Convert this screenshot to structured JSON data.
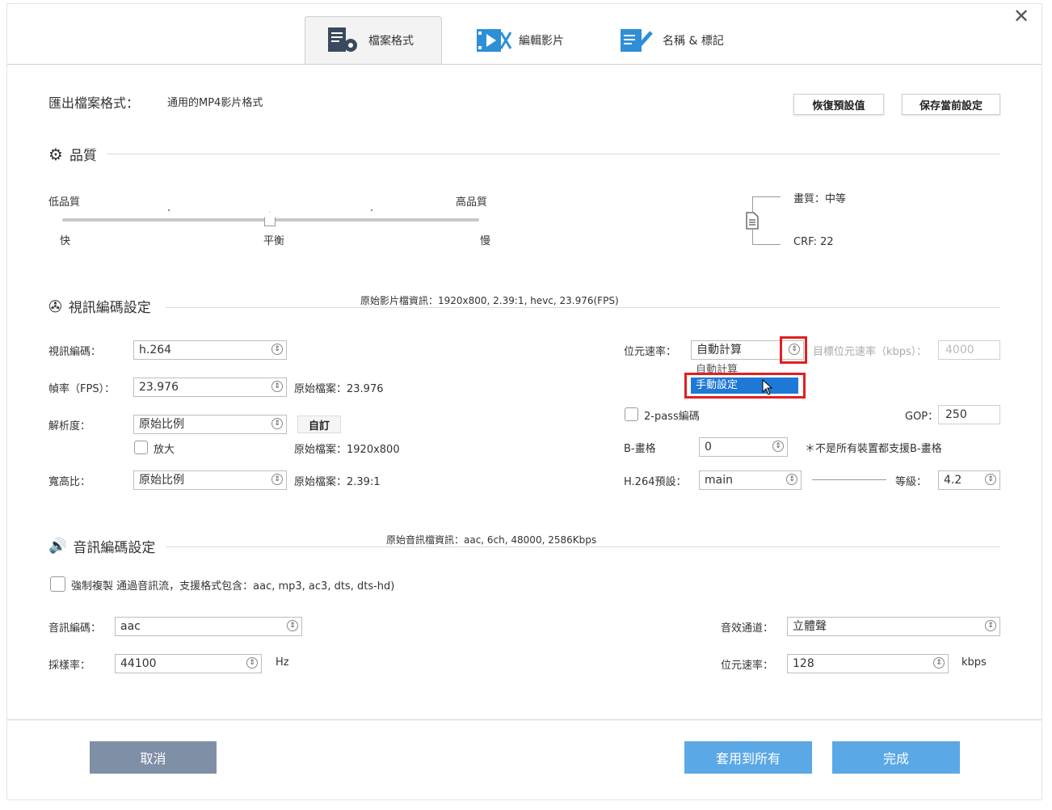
{
  "window": {
    "close_glyph": "✕"
  },
  "tabs": [
    {
      "label": "檔案格式",
      "icon": "file-settings-icon",
      "active": true
    },
    {
      "label": "編輯影片",
      "icon": "video-edit-icon",
      "active": false
    },
    {
      "label": "名稱 & 標記",
      "icon": "name-tag-icon",
      "active": false
    }
  ],
  "export": {
    "label": "匯出檔案格式：",
    "value": "通用的MP4影片格式",
    "restore_default": "恢復預設值",
    "save_current": "保存當前設定"
  },
  "quality": {
    "title": "品質",
    "low_label": "低品質",
    "high_label": "高品質",
    "fast_label": "快",
    "balance_label": "平衡",
    "slow_label": "慢",
    "slider_value": 0.5,
    "picture_quality": "畫質：中等",
    "crf": "CRF: 22"
  },
  "video": {
    "title": "視訊編碼設定",
    "source_info": "原始影片檔資訊：1920x800, 2.39:1, hevc, 23.976(FPS)",
    "codec_label": "視訊編碼：",
    "codec_value": "h.264",
    "fps_label": "幀率（FPS）：",
    "fps_value": "23.976",
    "fps_original": "原始檔案：23.976",
    "resolution_label": "解析度：",
    "resolution_value": "原始比例",
    "custom_button": "自訂",
    "upscale_label": "放大",
    "resolution_original": "原始檔案：1920x800",
    "aspect_label": "寬高比：",
    "aspect_value": "原始比例",
    "aspect_original": "原始檔案：2.39:1",
    "bitrate_label": "位元速率：",
    "bitrate_value": "自動計算",
    "bitrate_options": [
      "自動計算",
      "手動設定"
    ],
    "bitrate_highlighted": "手動設定",
    "target_bitrate_label": "目標位元速率（kbps）：",
    "target_bitrate_value": "4000",
    "twopass_label": "2-pass編碼",
    "gop_label": "GOP：",
    "gop_value": "250",
    "bframes_label": "B-畫格",
    "bframes_value": "0",
    "bframes_note": "＊不是所有裝置都支援B-畫格",
    "preset_label": "H.264預設：",
    "preset_value": "main",
    "level_label": "等級：",
    "level_value": "4.2"
  },
  "audio": {
    "title": "音訊編碼設定",
    "source_info": "原始音訊檔資訊：aac, 6ch, 48000, 2586Kbps",
    "passthrough_label": "強制複製 通過音訊流，支援格式包含：aac, mp3, ac3, dts, dts-hd)",
    "codec_label": "音訊編碼：",
    "codec_value": "aac",
    "samplerate_label": "採樣率：",
    "samplerate_value": "44100",
    "samplerate_unit": "Hz",
    "channel_label": "音效通道：",
    "channel_value": "立體聲",
    "bitrate_label": "位元速率：",
    "bitrate_value": "128",
    "bitrate_unit": "kbps"
  },
  "footer": {
    "cancel": "取消",
    "apply_all": "套用到所有",
    "done": "完成"
  },
  "colors": {
    "primary": "#5ba8e6",
    "cancel": "#7f8fa6",
    "highlight_red": "#e02020",
    "dropdown_selected": "#1e78d6"
  }
}
